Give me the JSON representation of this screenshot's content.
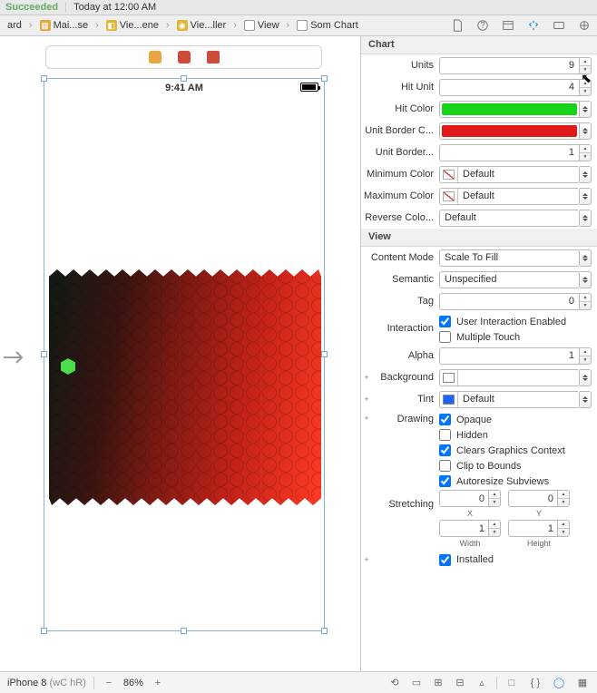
{
  "topbar": {
    "status": "Succeeded",
    "time_label": "Today at 12:00 AM"
  },
  "breadcrumb": {
    "items": [
      "ard",
      "Mai...se",
      "Vie...ene",
      "Vie...ller",
      "View",
      "Som Chart"
    ]
  },
  "statusbar": {
    "clock": "9:41 AM"
  },
  "inspector": {
    "section_chart": "Chart",
    "section_view": "View",
    "chart": {
      "units_label": "Units",
      "units_value": "9",
      "hit_unit_label": "Hit Unit",
      "hit_unit_value": "4",
      "hit_color_label": "Hit Color",
      "hit_color": "#19d319",
      "unit_border_color_label": "Unit Border C...",
      "unit_border_color": "#e01a1a",
      "unit_border_width_label": "Unit Border...",
      "unit_border_width_value": "1",
      "min_color_label": "Minimum Color",
      "min_color_text": "Default",
      "max_color_label": "Maximum Color",
      "max_color_text": "Default",
      "rev_color_label": "Reverse Colo...",
      "rev_color_text": "Default"
    },
    "view": {
      "content_mode_label": "Content Mode",
      "content_mode_value": "Scale To Fill",
      "semantic_label": "Semantic",
      "semantic_value": "Unspecified",
      "tag_label": "Tag",
      "tag_value": "0",
      "interaction_label": "Interaction",
      "interaction_uie": "User Interaction Enabled",
      "interaction_mt": "Multiple Touch",
      "alpha_label": "Alpha",
      "alpha_value": "1",
      "background_label": "Background",
      "tint_label": "Tint",
      "tint_text": "Default",
      "drawing_label": "Drawing",
      "drawing_opaque": "Opaque",
      "drawing_hidden": "Hidden",
      "drawing_cgc": "Clears Graphics Context",
      "drawing_ctb": "Clip to Bounds",
      "drawing_as": "Autoresize Subviews",
      "stretching_label": "Stretching",
      "stretch_x": "0",
      "stretch_y": "0",
      "stretch_w": "1",
      "stretch_h": "1",
      "sub_x": "X",
      "sub_y": "Y",
      "sub_w": "Width",
      "sub_h": "Height",
      "installed": "Installed"
    }
  },
  "bottombar": {
    "device": "iPhone 8",
    "size_class": "(wC hR)",
    "zoom": "86%"
  }
}
